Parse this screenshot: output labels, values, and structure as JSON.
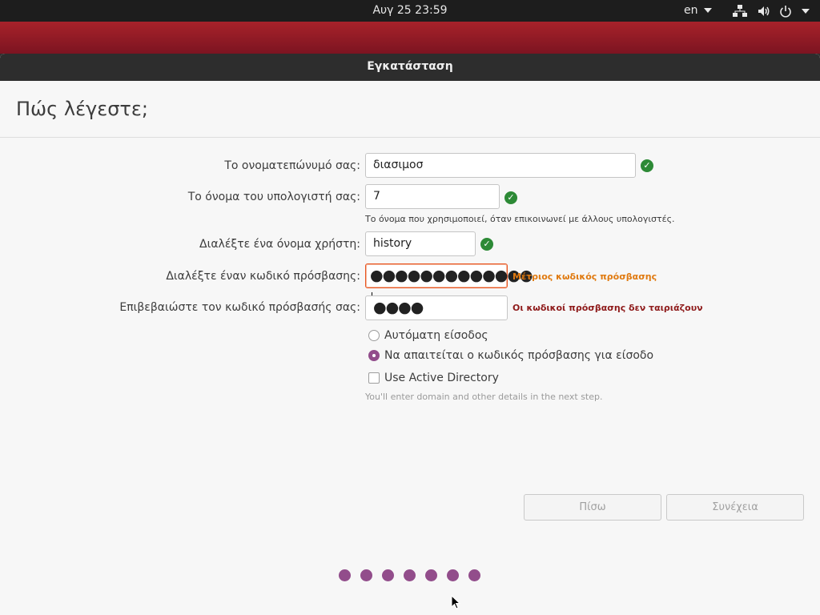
{
  "topbar": {
    "datetime": "Αυγ 25  23:59",
    "language": "en"
  },
  "window": {
    "title": "Εγκατάσταση"
  },
  "page": {
    "title": "Πώς λέγεστε;"
  },
  "form": {
    "fullname": {
      "label": "Το ονοματεπώνυμό σας:",
      "value": "διασιμοσ"
    },
    "hostname": {
      "label": "Το όνομα του υπολογιστή σας:",
      "value": "7",
      "hint": "Το όνομα που χρησιμοποιεί, όταν επικοινωνεί με άλλους υπολογιστές."
    },
    "username": {
      "label": "Διαλέξτε ένα όνομα χρήστη:",
      "value": "history"
    },
    "password": {
      "label": "Διαλέξτε έναν κωδικό πρόσβασης:",
      "masked": "●●●●●●●●●●●●●",
      "strength": "Μέτριος κωδικός πρόσβασης"
    },
    "confirm": {
      "label": "Επιβεβαιώστε τον κωδικό πρόσβασής σας:",
      "masked": "●●●●",
      "error": "Οι κωδικοί πρόσβασης δεν ταιριάζουν"
    },
    "login_options": {
      "auto": "Αυτόματη είσοδος",
      "require_password": "Να απαιτείται ο κωδικός πρόσβασης για είσοδο",
      "selected": "require_password"
    },
    "active_directory": {
      "label": "Use Active Directory",
      "checked": false,
      "note": "You'll enter domain and other details in the next step."
    }
  },
  "buttons": {
    "back": "Πίσω",
    "continue": "Συνέχεια"
  },
  "progress": {
    "steps_total": 7,
    "accent": "#924d8b"
  },
  "colors": {
    "ok": "#2d8a36",
    "warning": "#e07a10",
    "error": "#8e1a1a",
    "focus": "#e95420"
  }
}
